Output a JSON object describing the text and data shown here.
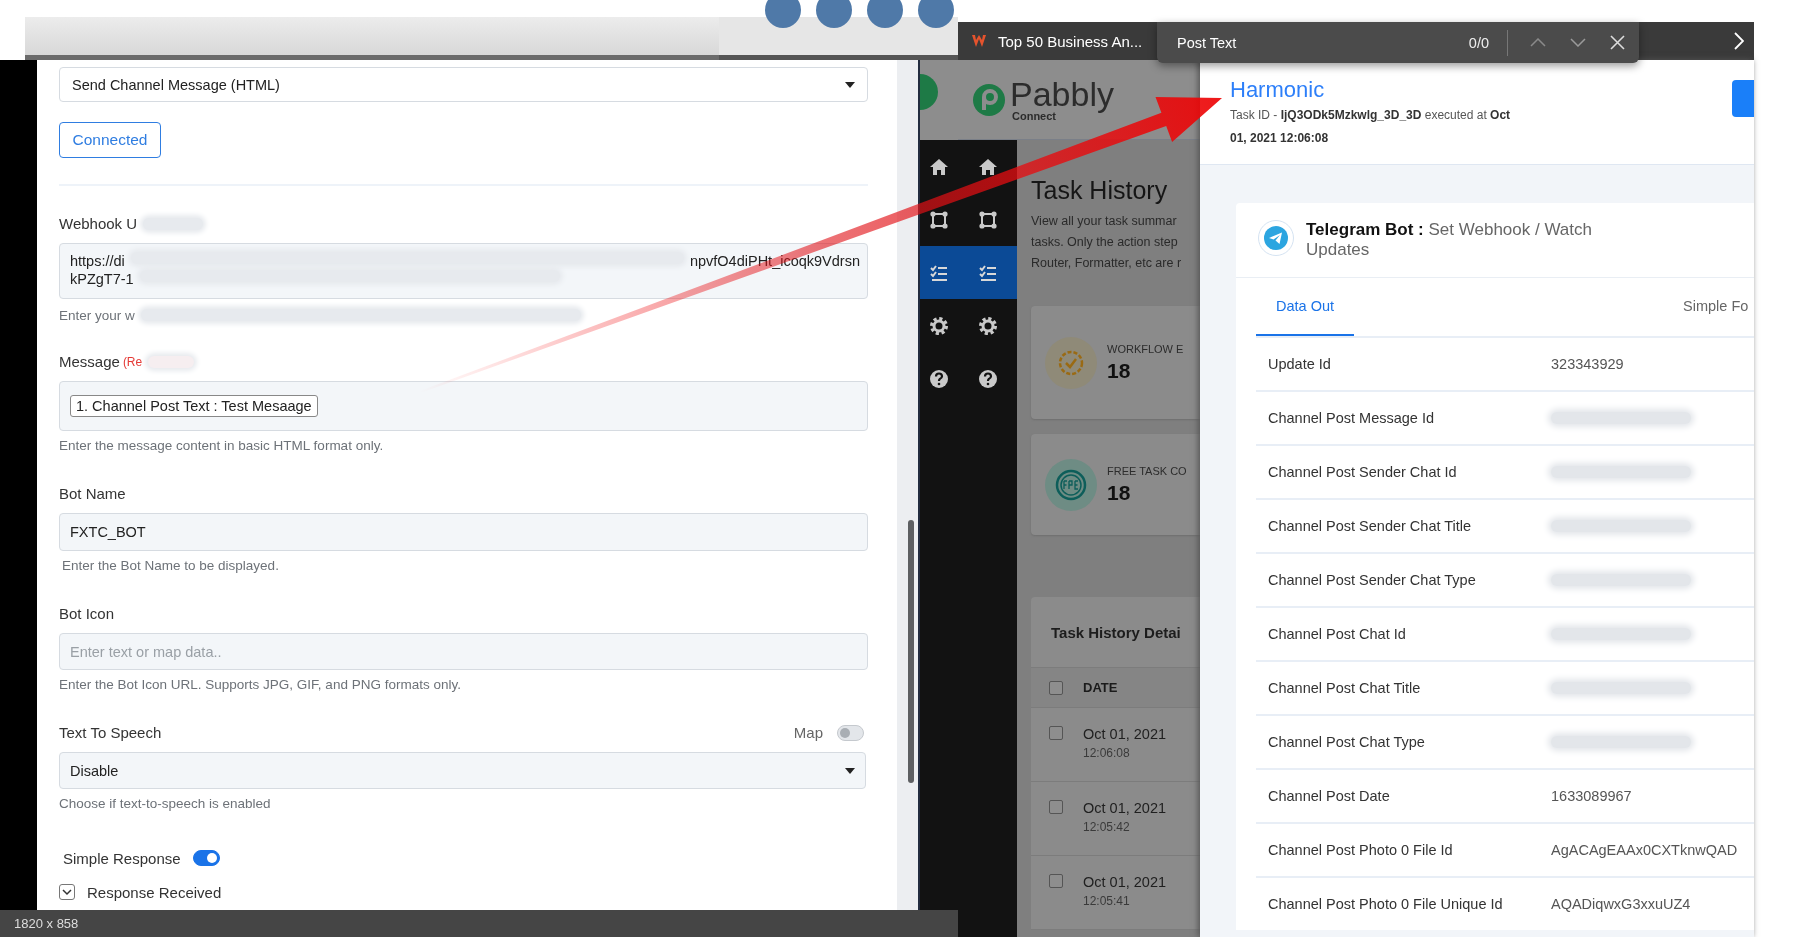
{
  "browser_tab": {
    "title": "Top 50 Business An..."
  },
  "find_bar": {
    "query": "Post Text",
    "count": "0/0"
  },
  "form": {
    "action": "Send Channel Message (HTML)",
    "connect_button": "Connected",
    "webhook": {
      "label": "Webhook U",
      "value_start": "https://di",
      "value_end": "npvfO4diPHt_icoqk9Vdrsn",
      "value_line_2": "kPZgT7-1",
      "help": "Enter your w"
    },
    "message": {
      "label": "Message",
      "required": "(Re",
      "token": "1. Channel Post Text : Test Mesaage",
      "help": "Enter the message content in basic HTML format only."
    },
    "bot_name": {
      "label": "Bot Name",
      "value": "FXTC_BOT",
      "help": "Enter the Bot Name to be displayed."
    },
    "bot_icon": {
      "label": "Bot Icon",
      "placeholder": "Enter text or map data..",
      "help": "Enter the Bot Icon URL. Supports JPG, GIF, and PNG formats only."
    },
    "text_to_speech": {
      "label": "Text To Speech",
      "map_label": "Map",
      "map_on": false,
      "value": "Disable",
      "help": "Choose if text-to-speech is enabled"
    },
    "simple_response": {
      "label": "Simple Response",
      "on": true
    },
    "response_received": {
      "label": "Response Received",
      "expanded": true
    }
  },
  "status_bar": {
    "dimensions": "1820 x 858"
  },
  "back_window_sidebar": [
    {
      "kind": "home",
      "selected": false
    },
    {
      "kind": "workflow",
      "selected": false
    },
    {
      "kind": "tasks",
      "selected": true
    },
    {
      "kind": "settings",
      "selected": false
    },
    {
      "kind": "help",
      "selected": false
    }
  ],
  "pabbly": {
    "logo_text": "Pabbly",
    "logo_sub": "Connect",
    "sidebar": [
      {
        "kind": "home",
        "selected": false
      },
      {
        "kind": "workflow",
        "selected": false
      },
      {
        "kind": "tasks",
        "selected": true
      },
      {
        "kind": "settings",
        "selected": false
      },
      {
        "kind": "help",
        "selected": false
      }
    ],
    "page_title": "Task History",
    "description": [
      "View all your task summar",
      "tasks. Only the action step",
      "Router, Formatter, etc are r"
    ],
    "stats": [
      {
        "kind": "workflow",
        "label": "WORKFLOW E",
        "value": "18"
      },
      {
        "kind": "free",
        "label": "FREE TASK CO",
        "value": "18"
      }
    ],
    "details": {
      "title": "Task History Detai",
      "column": "DATE",
      "header_checked": false,
      "rows": [
        {
          "date": "Oct 01, 2021",
          "time": "12:06:08",
          "checked": false
        },
        {
          "date": "Oct 01, 2021",
          "time": "12:05:42",
          "checked": false
        },
        {
          "date": "Oct 01, 2021",
          "time": "12:05:41",
          "checked": false
        }
      ]
    }
  },
  "task_detail": {
    "workflow": "Harmonic",
    "task_line": "Task ID - **IjQ3ODk5Mzkwlg_3D_3D** executed at **Oct 01, 2021 12:06:08**",
    "app_title": "**Telegram Bot :** Set Webhook / Watch Updates",
    "tabs": [
      {
        "label": "Data Out",
        "selected": true
      },
      {
        "label": "Simple Fo",
        "selected": false
      }
    ],
    "rows": [
      {
        "label": "Update Id",
        "value": "323343929",
        "redacted": false
      },
      {
        "label": "Channel Post Message Id",
        "redacted": true
      },
      {
        "label": "Channel Post Sender Chat Id",
        "redacted": true
      },
      {
        "label": "Channel Post Sender Chat Title",
        "redacted": true
      },
      {
        "label": "Channel Post Sender Chat Type",
        "redacted": true
      },
      {
        "label": "Channel Post Chat Id",
        "redacted": true
      },
      {
        "label": "Channel Post Chat Title",
        "redacted": true
      },
      {
        "label": "Channel Post Chat Type",
        "redacted": true
      },
      {
        "label": "Channel Post Date",
        "value": "1633089967",
        "redacted": false
      },
      {
        "label": "Channel Post Photo 0 File Id",
        "value": "AgACAgEAAx0CXTknwQAD",
        "redacted": false
      },
      {
        "label": "Channel Post Photo 0 File Unique Id",
        "value": "AQADiqwxG3xxuUZ4",
        "redacted": false
      }
    ]
  }
}
